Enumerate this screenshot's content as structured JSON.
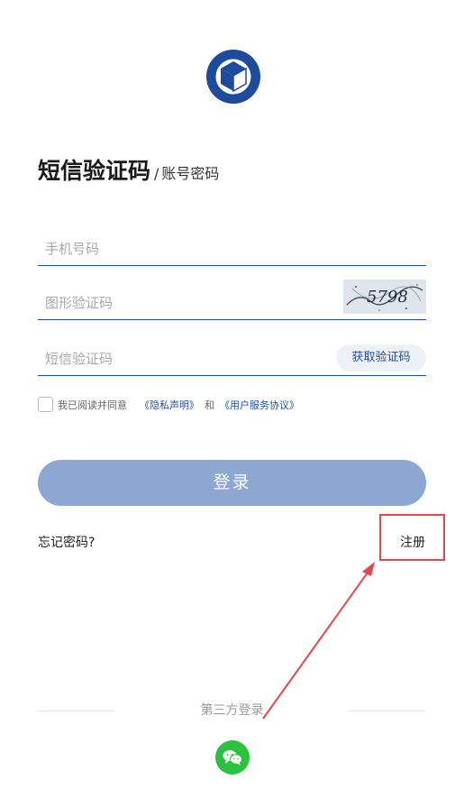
{
  "header": {
    "title_active": "短信验证码",
    "title_separator": "/",
    "title_alt": "账号密码"
  },
  "form": {
    "phone_placeholder": "手机号码",
    "captcha_placeholder": "图形验证码",
    "captcha_text": "5798",
    "sms_placeholder": "短信验证码",
    "get_code_label": "获取验证码"
  },
  "agreement": {
    "prefix": "我已阅读并同意",
    "privacy_link": "《隐私声明》",
    "and": "和",
    "terms_link": "《用户服务协议》"
  },
  "login_label": "登录",
  "forgot_label": "忘记密码?",
  "register_label": "注册",
  "third_party": {
    "label": "第三方登录",
    "icon": "wechat-icon"
  },
  "colors": {
    "primary": "#1e4f9c",
    "button": "#8ca7d1",
    "highlight": "#e4464f",
    "wechat": "#2ac23e"
  }
}
